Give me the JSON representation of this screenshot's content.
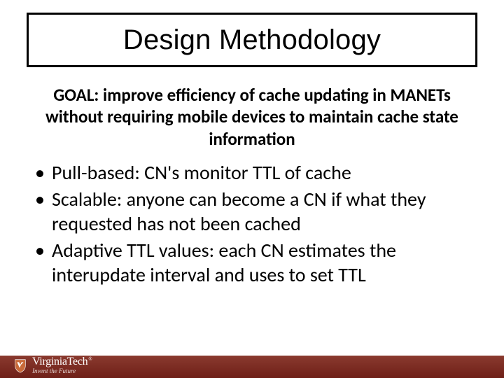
{
  "title": "Design Methodology",
  "goal": "GOAL: improve efficiency of cache updating in MANETs without requiring mobile devices to maintain cache state information",
  "bullets": [
    "Pull-based: CN's monitor TTL of cache",
    "Scalable: anyone can become a CN if what they requested has not been cached",
    "Adaptive TTL values: each CN estimates the interupdate interval and uses to set TTL"
  ],
  "footer": {
    "org": "VirginiaTech",
    "tagline": "Invent the Future",
    "tm": "®"
  },
  "colors": {
    "footer_bar": "#7a2a20"
  }
}
